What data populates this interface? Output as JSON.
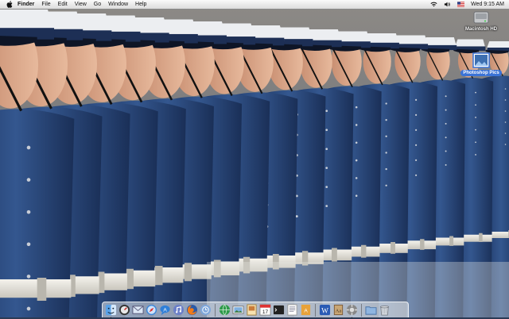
{
  "menubar": {
    "apple_icon": "apple-icon",
    "items": [
      "Finder",
      "File",
      "Edit",
      "View",
      "Go",
      "Window",
      "Help"
    ],
    "status_icons": [
      "wifi-icon",
      "volume-icon",
      "flag-icon"
    ],
    "clock": "Wed 9:15 AM"
  },
  "desktop": {
    "icons": [
      {
        "label": "Macintosh HD",
        "icon": "hard-drive-icon"
      },
      {
        "label": "Photoshop Pics",
        "icon": "image-file-icon",
        "selected": true
      }
    ]
  },
  "dock": {
    "left_apps": [
      "finder-icon",
      "dashboard-icon",
      "mail-icon",
      "safari-icon",
      "ichat-icon",
      "itunes-icon",
      "firefox-icon",
      "calendar-icon"
    ],
    "mid_apps": [
      "globe-icon",
      "photos-icon",
      "preview-icon",
      "ical-icon",
      "terminal-icon",
      "textedit-icon",
      "script-icon"
    ],
    "right_apps": [
      "word-icon",
      "dictionary-icon",
      "system-preferences-icon"
    ],
    "trash_items": [
      "folder-icon",
      "trash-icon"
    ]
  },
  "colors": {
    "uniform_blue": "#2a4a7e",
    "belt_white": "#e8e6df",
    "cap_white": "#e9ebee",
    "selection_blue": "#3b73d6"
  }
}
